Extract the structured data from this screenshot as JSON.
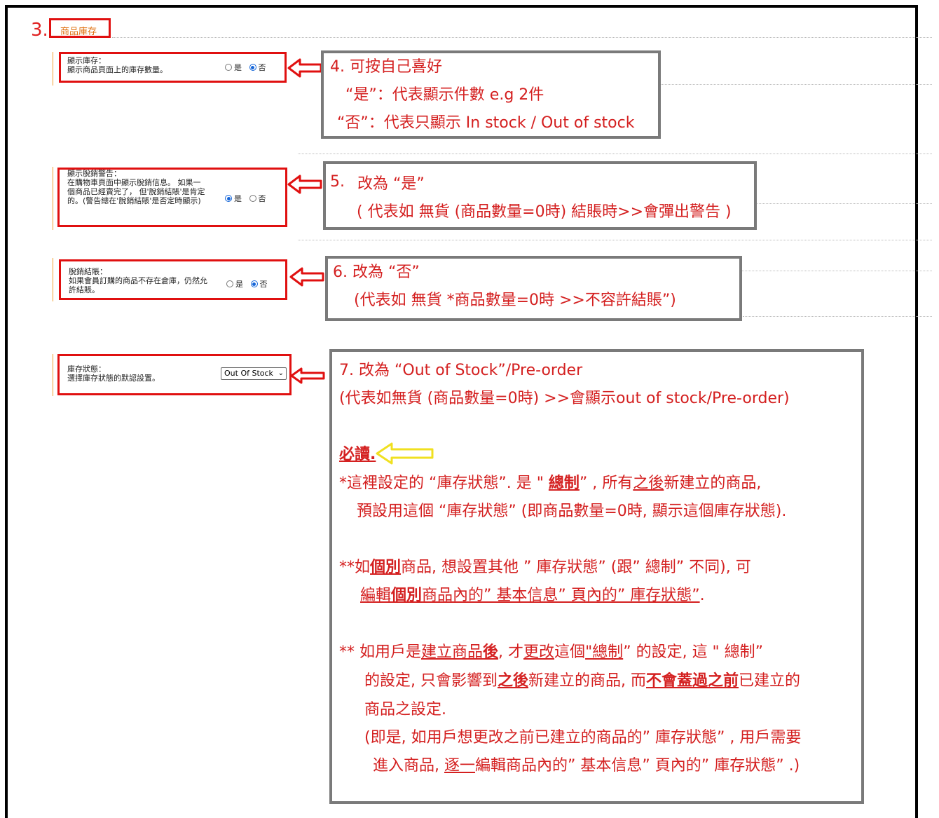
{
  "section": {
    "step": "3.",
    "title": "商品庫存"
  },
  "settings": [
    {
      "label": "顯示庫存：",
      "desc": "顯示商品頁面上的庫存數量。",
      "yes": "是",
      "no": "否",
      "selected": "no"
    },
    {
      "label": "顯示脫銷警告：",
      "desc": "在購物車頁面中顯示脫銷信息。 如果一個商品已經賣完了， 但'脫銷結賬'是肯定的。(警告總在'脫銷結賬'是否定時顯示)",
      "yes": "是",
      "no": "否",
      "selected": "yes"
    },
    {
      "label": "脫銷結賬：",
      "desc": "如果會員訂購的商品不存在倉庫，仍然允許結賬。",
      "yes": "是",
      "no": "否",
      "selected": "no"
    },
    {
      "label": "庫存狀態：",
      "desc": "選擇庫存狀態的默認設置。",
      "select_value": "Out Of Stock"
    }
  ],
  "note4": {
    "l1": "4. 可按自己喜好",
    "l2": "“是”：代表顯示件數 e.g 2件",
    "l3": "“否”：代表只顯示 In stock /  Out of stock"
  },
  "note5": {
    "num": "5.",
    "l1": "改為  “是”",
    "l2": "( 代表如 無貨 (商品數量=0時) 結賬時>>會彈出警告 )"
  },
  "note6": {
    "l1": "6. 改為  “否”",
    "l2": "(代表如 無貨 *商品數量=0時 >>不容許結賬”)"
  },
  "note7": {
    "l1": "7. 改為  “Out of Stock”/Pre-order",
    "l2": "(代表如無貨 (商品數量=0時) >>會顯示out of stock/Pre-order)",
    "must": "必讀.",
    "p1a": "*這裡設定的  “庫存狀態”. 是 \" ",
    "p1b": "總制",
    "p1c": "”  , 所有",
    "p1d": "之後",
    "p1e": "新建立的商品,",
    "p2": "預設用這個  “庫存狀態”  (即商品數量=0時, 顯示這個庫存狀態).",
    "p3a": "**如",
    "p3b": "個別",
    "p3c": "商品, 想設置其他 ”  庫存狀態”  (跟”  總制”  不同), 可",
    "p4a": "編輯",
    "p4b": "個別",
    "p4c": "商品內的”  基本信息”  頁內的”  庫存狀態”",
    "p4d": ".",
    "p5a": "** 如用戶是",
    "p5b": "建立商品",
    "p5c": "後",
    "p5d": ", 才",
    "p5e": "更改",
    "p5f": "這個",
    "p5g": "\"總制",
    "p5h": "”  的設定,  這 \" 總制”",
    "p6a": "的設定, 只會影響到",
    "p6b": "之後",
    "p6c": "新建立的商品, 而",
    "p6d": "不會蓋過之前",
    "p6e": "已建立的",
    "p7": "商品之設定.",
    "p8": "(即是, 如用戶想更改之前已建立的商品的”  庫存狀態”  , 用戶需要",
    "p9a": "進入商品, ",
    "p9b": "逐一",
    "p9c": "編輯商品內的”  基本信息”  頁內的”  庫存狀態”  .)"
  }
}
